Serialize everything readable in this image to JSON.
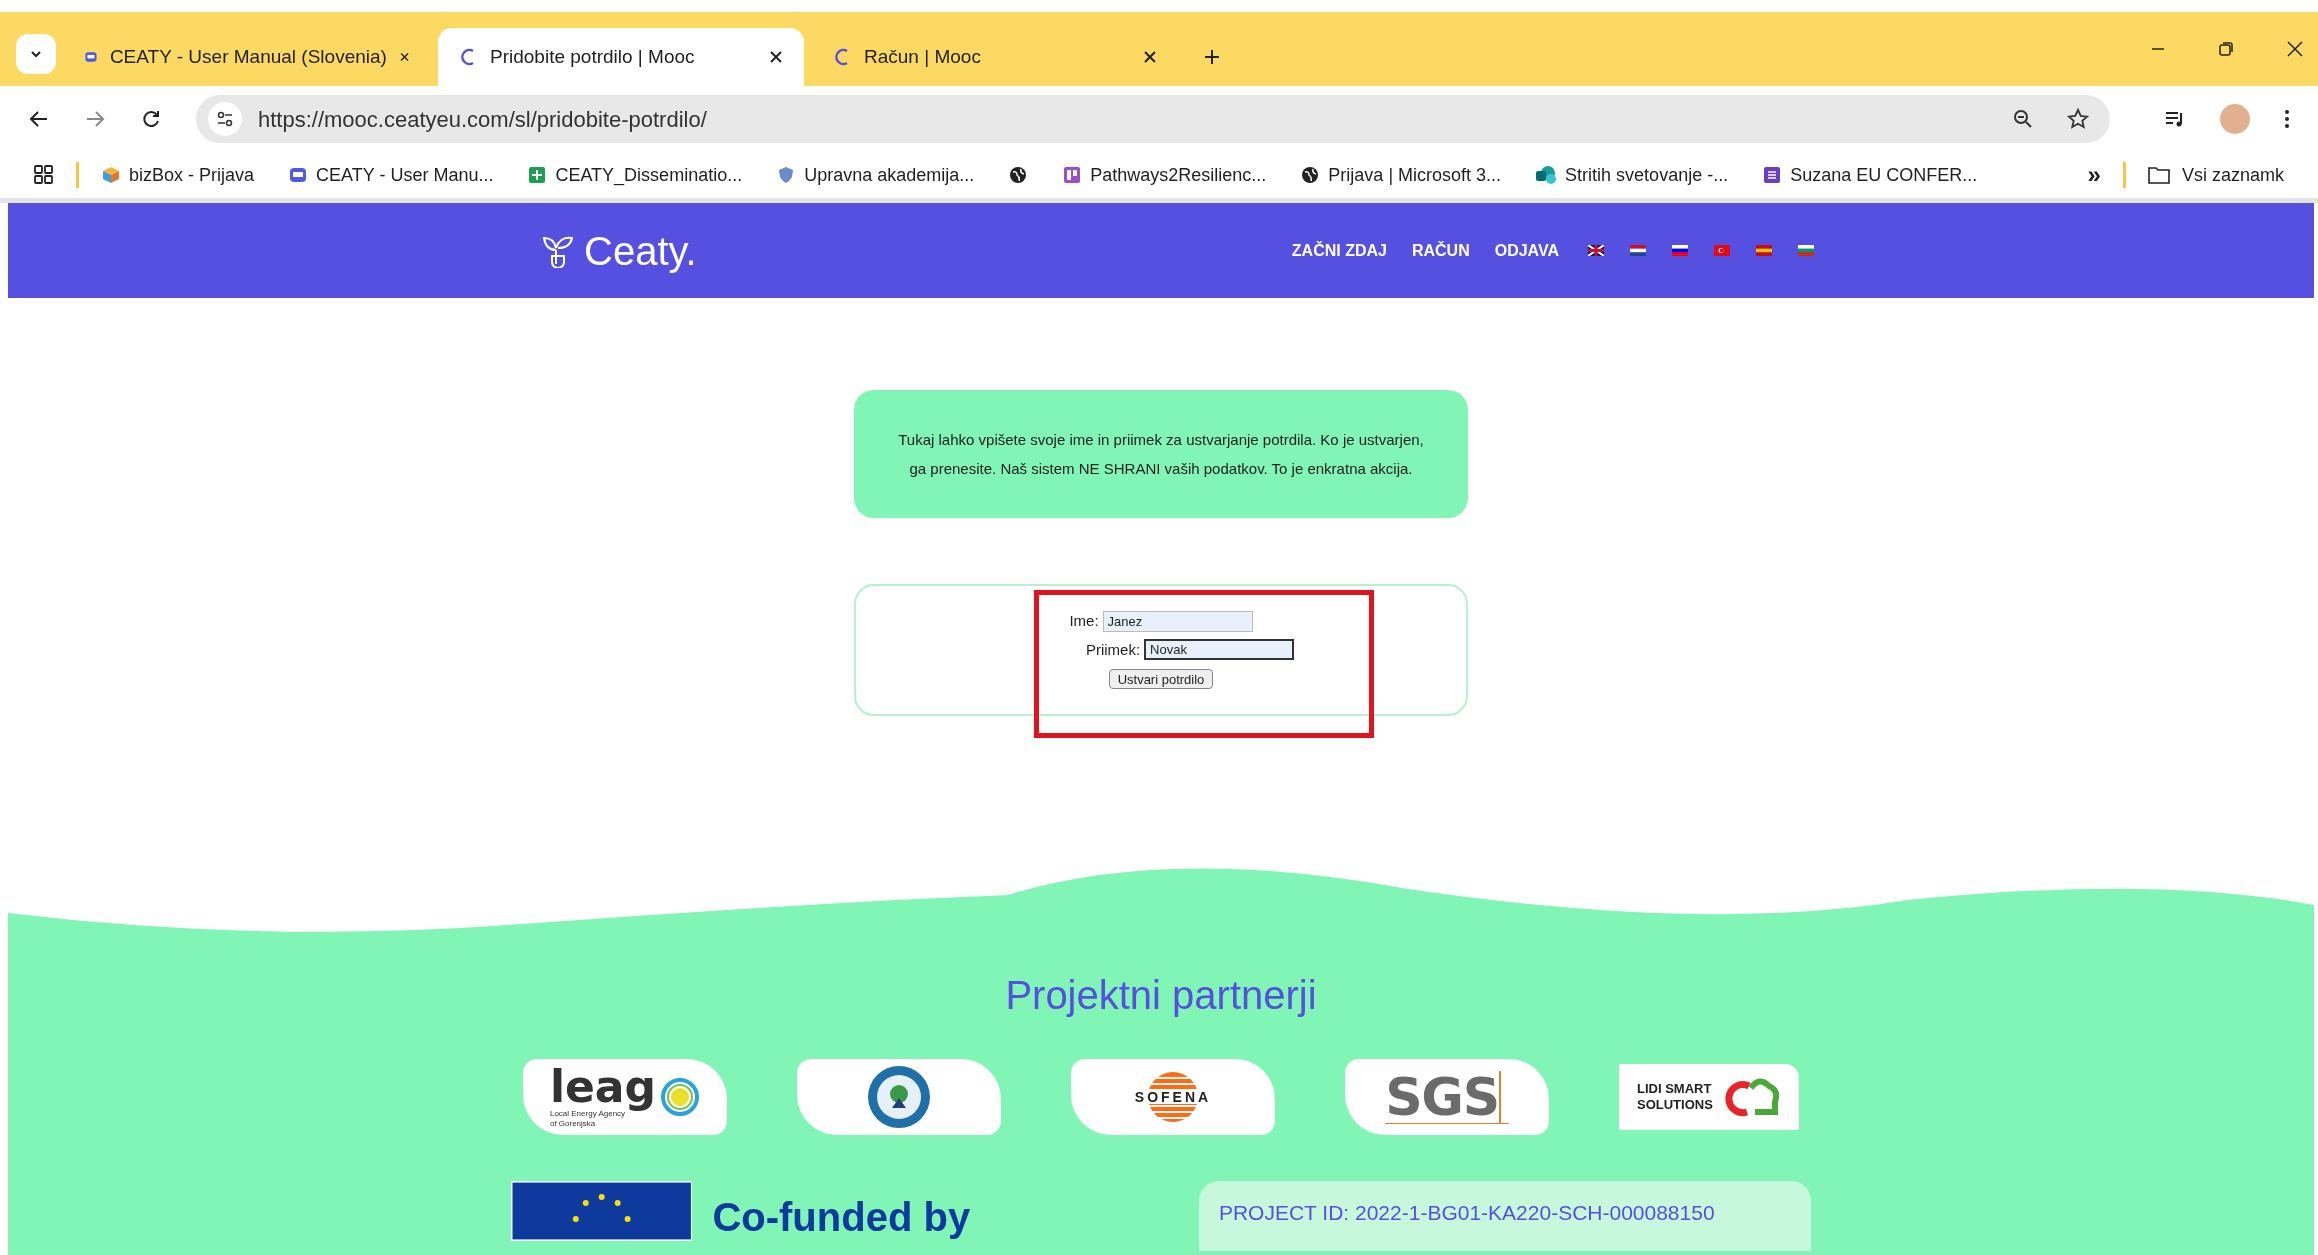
{
  "browser": {
    "tabs": [
      {
        "title": "CEATY - User Manual (Slovenia)",
        "selected": false,
        "kind": "doc"
      },
      {
        "title": "Pridobite potrdilo | Mooc",
        "selected": true,
        "kind": "c"
      },
      {
        "title": "Račun | Mooc",
        "selected": false,
        "kind": "c"
      }
    ],
    "url": "https://mooc.ceatyeu.com/sl/pridobite-potrdilo/",
    "bookmarks": [
      {
        "label": "bizBox - Prijava",
        "kind": "cube"
      },
      {
        "label": "CEATY - User Manu...",
        "kind": "doc"
      },
      {
        "label": "CEATY_Disseminatio...",
        "kind": "sheet"
      },
      {
        "label": "Upravna akademija...",
        "kind": "shield"
      },
      {
        "kind": "globe"
      },
      {
        "label": "Pathways2Resilienc...",
        "kind": "board"
      },
      {
        "label": "Prijava | Microsoft 3...",
        "kind": "globe"
      },
      {
        "label": "Stritih svetovanje -...",
        "kind": "share"
      },
      {
        "label": "Suzana EU CONFER...",
        "kind": "form"
      }
    ],
    "more": "»",
    "all_bookmarks": "Vsi zaznamk"
  },
  "header": {
    "logo": "Ceaty.",
    "nav": [
      "ZAČNI ZDAJ",
      "RAČUN",
      "ODJAVA"
    ],
    "flags": [
      {
        "kind": "uk"
      },
      {
        "kind": "nl"
      },
      {
        "kind": "si"
      },
      {
        "kind": "tr"
      },
      {
        "kind": "es"
      },
      {
        "kind": "bg"
      }
    ]
  },
  "notice": "Tukaj lahko vpišete svoje ime in priimek za ustvarjanje potrdila. Ko je ustvarjen, ga prenesite. Naš sistem NE SHRANI vaših podatkov. To je enkratna akcija.",
  "form": {
    "fields": [
      {
        "label": "Ime:",
        "value": "Janez",
        "focused": false
      },
      {
        "label": "Priimek:",
        "value": "Novak",
        "focused": true
      }
    ],
    "button": "Ustvari potrdilo"
  },
  "partners": {
    "title": "Projektni partnerji",
    "logos": [
      {
        "kind": "leag",
        "text": "leag",
        "subtext": "Local Energy Agency of Gorenjska"
      },
      {
        "kind": "round"
      },
      {
        "kind": "sofena",
        "text": "SOFENA"
      },
      {
        "kind": "sgs",
        "text": "SGS"
      },
      {
        "kind": "lidi",
        "text": "LIDI SMART SOLUTIONS"
      }
    ]
  },
  "footer": {
    "cofunded": "Co-funded by",
    "project_id": "PROJECT ID: 2022-1-BG01-KA220-SCH-000088150"
  }
}
